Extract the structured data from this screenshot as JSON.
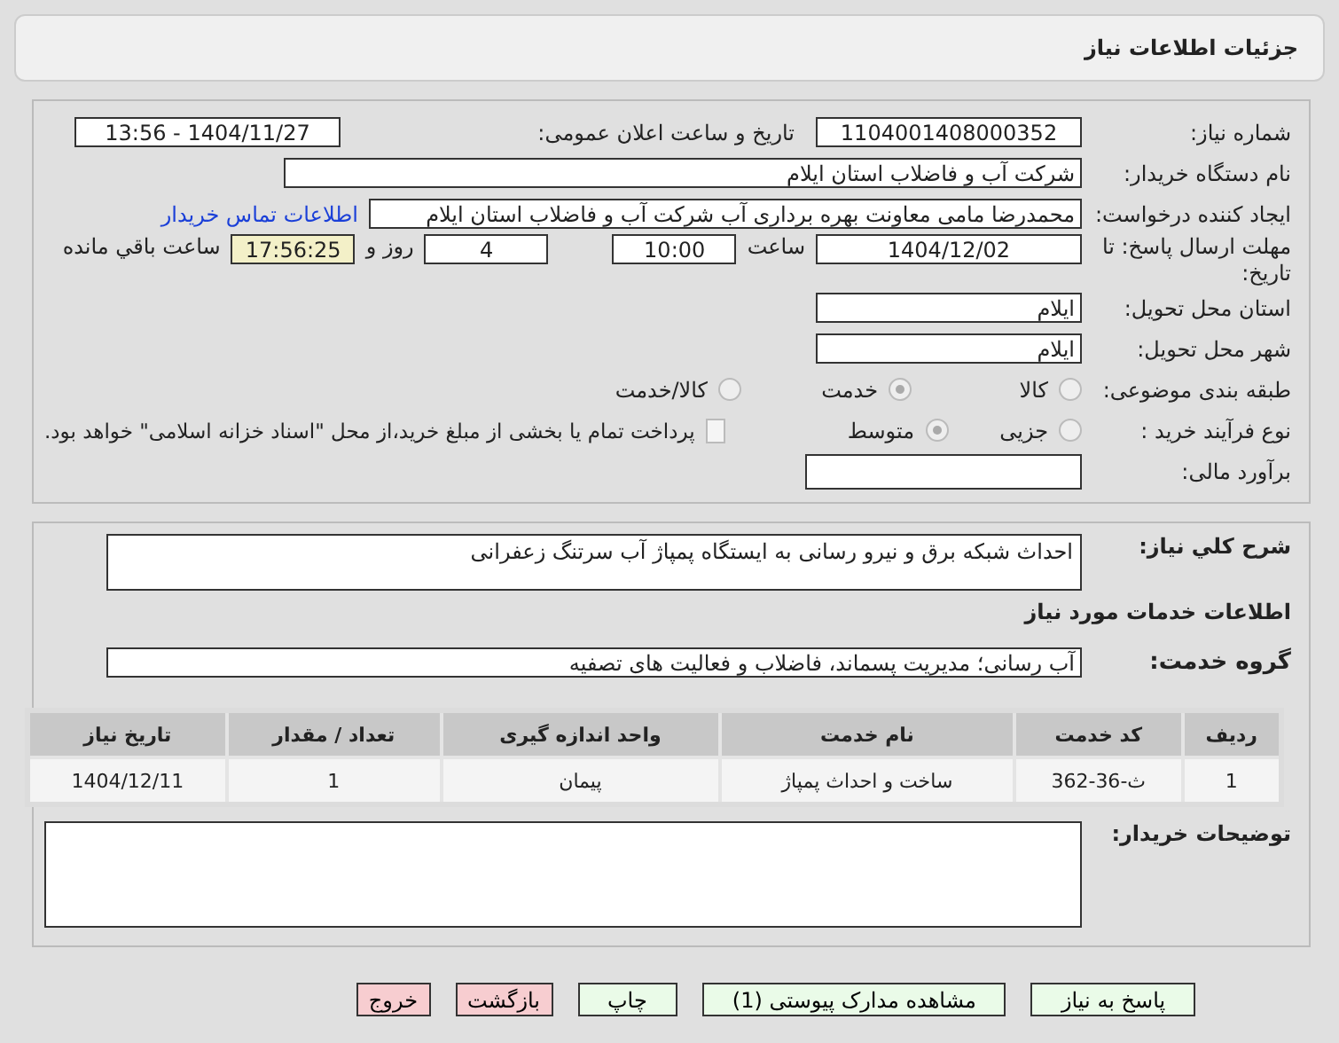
{
  "header": {
    "title": "جزئیات اطلاعات نیاز"
  },
  "need_number": {
    "label": "شماره نیاز:",
    "value": "1104001408000352"
  },
  "announce": {
    "label": "تاریخ و ساعت اعلان عمومی:",
    "value": "1404/11/27 - 13:56"
  },
  "buyer": {
    "label": "نام دستگاه خریدار:",
    "value": "شرکت آب و فاضلاب استان ایلام"
  },
  "creator": {
    "label": "ایجاد کننده درخواست:",
    "value": "محمدرضا مامی معاونت بهره برداری آب  شرکت آب و فاضلاب استان ایلام",
    "link": "اطلاعات تماس خریدار"
  },
  "deadline": {
    "label": "مهلت ارسال پاسخ: تا تاریخ:",
    "date": "1404/12/02",
    "time_label": "ساعت",
    "time": "10:00",
    "days": "4",
    "days_label": "روز و",
    "remaining": "17:56:25",
    "remaining_label": "ساعت باقي مانده"
  },
  "province": {
    "label": "استان محل تحویل:",
    "value": "ایلام"
  },
  "city": {
    "label": "شهر محل تحویل:",
    "value": "ایلام"
  },
  "category": {
    "label": "طبقه بندی موضوعی:",
    "options": [
      {
        "label": "کالا",
        "selected": false
      },
      {
        "label": "خدمت",
        "selected": true
      },
      {
        "label": "کالا/خدمت",
        "selected": false
      }
    ]
  },
  "process": {
    "label": "نوع فرآیند خرید :",
    "options": [
      {
        "label": "جزیی",
        "selected": false
      },
      {
        "label": "متوسط",
        "selected": true
      }
    ],
    "payment": {
      "label": "پرداخت تمام یا بخشی از مبلغ خرید،از محل \"اسناد خزانه اسلامی\" خواهد بود.",
      "checked": false
    }
  },
  "estimate": {
    "label": "برآورد مالی:"
  },
  "summary": {
    "label": "شرح کلي نیاز:",
    "value": "احداث شبکه برق و نیرو رسانی به ایستگاه پمپاژ آب سرتنگ زعفرانی"
  },
  "services_title": "اطلاعات خدمات مورد نیاز",
  "service_group": {
    "label": "گروه خدمت:",
    "value": "آب رسانی؛ مدیریت پسماند، فاضلاب و فعالیت های تصفیه"
  },
  "table": {
    "columns": [
      "ردیف",
      "کد خدمت",
      "نام خدمت",
      "واحد اندازه گیری",
      "تعداد / مقدار",
      "تاریخ نیاز"
    ],
    "rows": [
      [
        "1",
        "ث-36-362",
        "ساخت و احداث پمپاژ",
        "پیمان",
        "1",
        "1404/12/11"
      ]
    ]
  },
  "notes": {
    "label": "توضیحات خریدار:"
  },
  "buttons": [
    {
      "label": "پاسخ به نیاز",
      "kind": "action"
    },
    {
      "label": "مشاهده مدارک پیوستی (1)",
      "kind": "action"
    },
    {
      "label": "چاپ",
      "kind": "action"
    },
    {
      "label": "بازگشت",
      "kind": "exit"
    },
    {
      "label": "خروج",
      "kind": "exit"
    }
  ]
}
